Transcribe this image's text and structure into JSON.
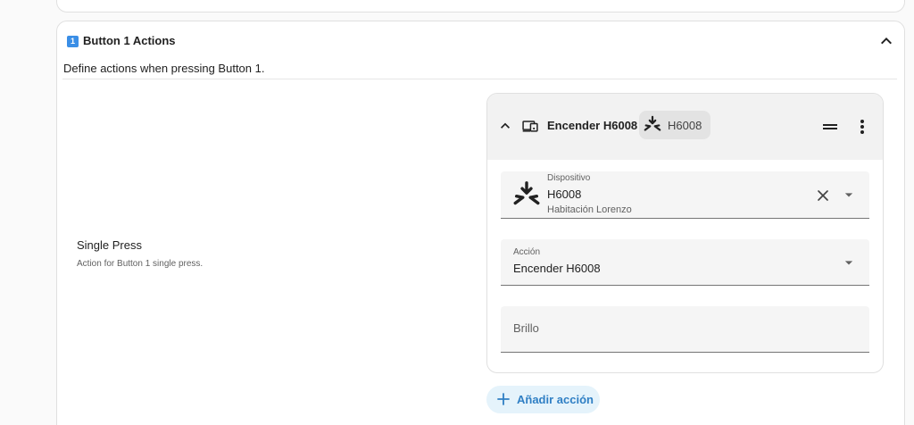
{
  "section": {
    "badge": "1",
    "title": "Button 1 Actions",
    "description": "Define actions when pressing Button 1."
  },
  "field": {
    "label": "Single Press",
    "help": "Action for Button 1 single press."
  },
  "action_card": {
    "title": "Encender H6008",
    "chip_label": "H6008",
    "device": {
      "label": "Dispositivo",
      "value": "H6008",
      "area": "Habitación Lorenzo"
    },
    "action": {
      "label": "Acción",
      "value": "Encender H6008"
    },
    "brightness": {
      "placeholder": "Brillo"
    }
  },
  "add_action_label": "Añadir acción",
  "colors": {
    "accent": "#2f7fc4",
    "add_button_bg": "#e5f3fb",
    "badge": "#3a8ee6"
  },
  "icons": [
    "chevron-up-icon",
    "chevron-down-icon",
    "devices-icon",
    "govee-device-icon",
    "drag-handle-icon",
    "dots-vertical-icon",
    "close-icon",
    "menu-down-icon",
    "plus-icon"
  ]
}
